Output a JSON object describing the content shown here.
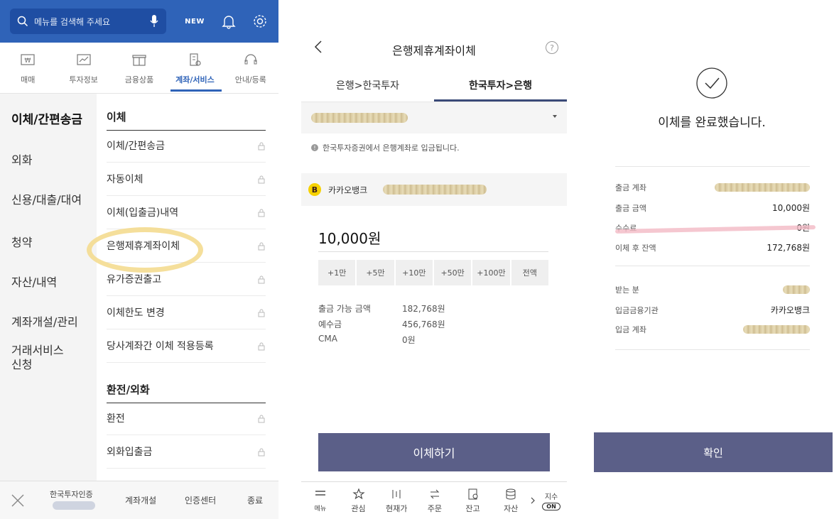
{
  "panel1": {
    "search": {
      "placeholder": "메뉴를 검색해 주세요",
      "new_label": "NEW"
    },
    "categories": [
      {
        "label": "매매",
        "icon": "trade-icon"
      },
      {
        "label": "투자정보",
        "icon": "chart-icon"
      },
      {
        "label": "금융상품",
        "icon": "gift-icon"
      },
      {
        "label": "계좌/서비스",
        "icon": "building-icon",
        "active": true
      },
      {
        "label": "안내/등록",
        "icon": "headset-icon"
      }
    ],
    "left_menu": [
      "이체/간편송금",
      "외화",
      "신용/대출/대여",
      "청약",
      "자산/내역",
      "계좌개설/관리",
      "거래서비스\n신청"
    ],
    "section1_title": "이체",
    "section1_items": [
      "이체/간편송금",
      "자동이체",
      "이체(입출금)내역",
      "은행제휴계좌이체",
      "유가증권출고",
      "이체한도 변경",
      "당사계좌간 이체 적용등록"
    ],
    "section2_title": "환전/외화",
    "section2_items": [
      "환전",
      "외화입출금"
    ],
    "bottom": {
      "cert_title": "한국투자인증",
      "open_account": "계좌개설",
      "cert_center": "인증센터",
      "exit": "종료"
    }
  },
  "panel2": {
    "title": "은행제휴계좌이체",
    "help": "?",
    "tabs": [
      "은행>한국투자",
      "한국투자>은행"
    ],
    "notice": "한국투자증권에서 은행계좌로 입금됩니다.",
    "bank_name": "카카오뱅크",
    "amount": "10,000원",
    "quick_buttons": [
      "+1만",
      "+5만",
      "+10만",
      "+50만",
      "+100만",
      "전액"
    ],
    "info": [
      {
        "k": "출금 가능 금액",
        "v": "182,768원"
      },
      {
        "k": "예수금",
        "v": "456,768원"
      },
      {
        "k": "CMA",
        "v": "0원"
      }
    ],
    "transfer_button": "이체하기",
    "tabbar": [
      {
        "label": "메뉴",
        "icon": "menu-icon"
      },
      {
        "label": "관심",
        "icon": "star-icon"
      },
      {
        "label": "현재가",
        "icon": "price-icon"
      },
      {
        "label": "주문",
        "icon": "order-icon"
      },
      {
        "label": "잔고",
        "icon": "balance-icon"
      },
      {
        "label": "자산",
        "icon": "database-icon"
      }
    ],
    "index_label": "지수",
    "index_toggle": "ON"
  },
  "panel3": {
    "title": "이체를 완료했습니다.",
    "rows_top": [
      {
        "k": "출금 계좌",
        "v": ""
      },
      {
        "k": "출금 금액",
        "v": "10,000원"
      },
      {
        "k": "수수료",
        "v": "0원"
      },
      {
        "k": "이체 후 잔액",
        "v": "172,768원"
      }
    ],
    "rows_bottom": [
      {
        "k": "받는 분",
        "v": ""
      },
      {
        "k": "입금금융기관",
        "v": "카카오뱅크"
      },
      {
        "k": "입금 계좌",
        "v": ""
      }
    ],
    "confirm_button": "확인"
  }
}
